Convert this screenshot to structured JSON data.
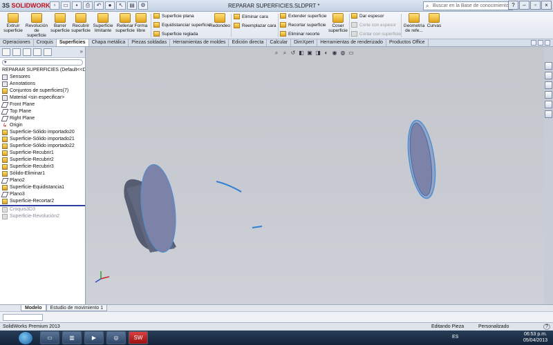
{
  "app": {
    "brand": "SOLIDWORKS",
    "window_title": "REPARAR SUPERFICIES.SLDPRT *",
    "search_placeholder": "Buscar en la Base de conocimiento"
  },
  "ribbon": {
    "big_buttons": [
      {
        "label": "Extruir superficie"
      },
      {
        "label": "Revolución de superficie"
      },
      {
        "label": "Barrer superficie"
      },
      {
        "label": "Recubrir superficie"
      },
      {
        "label": "Superficie limitante"
      },
      {
        "label": "Rellenar superficie"
      },
      {
        "label": "Forma libre"
      }
    ],
    "col1": [
      {
        "label": "Superficie plana"
      },
      {
        "label": "Equidistanciar superficie"
      },
      {
        "label": "Superficie reglada"
      }
    ],
    "redondeo": "Redondeo",
    "col2": [
      {
        "label": "Eliminar cara"
      },
      {
        "label": "Reemplazar cara"
      }
    ],
    "col3": [
      {
        "label": "Extender superficie"
      },
      {
        "label": "Recortar superficie"
      },
      {
        "label": "Eliminar recorte"
      }
    ],
    "coser": "Coser superficie",
    "col4": [
      {
        "label": "Dar espesor"
      },
      {
        "label": "Corte con espesor"
      },
      {
        "label": "Cortar con superficie"
      }
    ],
    "geometria": "Geometría de refe...",
    "curvas": "Curvas"
  },
  "tabs": [
    "Operaciones",
    "Croquis",
    "Superficies",
    "Chapa metálica",
    "Piezas soldadas",
    "Herramientas de moldes",
    "Edición directa",
    "Calcular",
    "DimXpert",
    "Herramientas de renderizado",
    "Productos Office"
  ],
  "active_tab": "Superficies",
  "tree": {
    "root": "REPARAR SUPERFICIES  (Default<<Default>",
    "items": [
      {
        "label": "Sensores",
        "kind": "doc"
      },
      {
        "label": "Annotations",
        "kind": "doc"
      },
      {
        "label": "Conjuntos de superficies(7)",
        "kind": "feat"
      },
      {
        "label": "Material <sin especificar>",
        "kind": "doc"
      },
      {
        "label": "Front Plane",
        "kind": "plane"
      },
      {
        "label": "Top Plane",
        "kind": "plane"
      },
      {
        "label": "Right Plane",
        "kind": "plane"
      },
      {
        "label": "Origin",
        "kind": "origin"
      },
      {
        "label": "Superficie-Sólido importado20",
        "kind": "feat"
      },
      {
        "label": "Superficie-Sólido importado21",
        "kind": "feat"
      },
      {
        "label": "Superficie-Sólido importado22",
        "kind": "feat"
      },
      {
        "label": "Superficie-Recubrir1",
        "kind": "feat"
      },
      {
        "label": "Superficie-Recubrir2",
        "kind": "feat"
      },
      {
        "label": "Superficie-Recubrir3",
        "kind": "feat"
      },
      {
        "label": "Sólido-Eliminar1",
        "kind": "feat"
      },
      {
        "label": "Plano2",
        "kind": "plane"
      },
      {
        "label": "Superficie-Equidistancia1",
        "kind": "feat"
      },
      {
        "label": "Plano3",
        "kind": "plane"
      },
      {
        "label": "Superficie-Recortar2",
        "kind": "feat"
      }
    ],
    "suppressed": [
      {
        "label": "Croquis3D3"
      },
      {
        "label": "Superficie-Revolución2"
      }
    ]
  },
  "bottom_tabs": [
    "Modelo",
    "Estudio de movimiento 1"
  ],
  "status": {
    "product": "SolidWorks Premium 2013",
    "mode": "Editando Pieza",
    "units": "Personalizado",
    "help": "?"
  },
  "taskbar": {
    "sw_label": "SW",
    "lang": "ES",
    "time": "06:53 p.m.",
    "date": "05/04/2013"
  },
  "colors": {
    "accent": "#c2101a",
    "part_face": "#7c82a8",
    "part_edge": "#4b8fd6"
  }
}
